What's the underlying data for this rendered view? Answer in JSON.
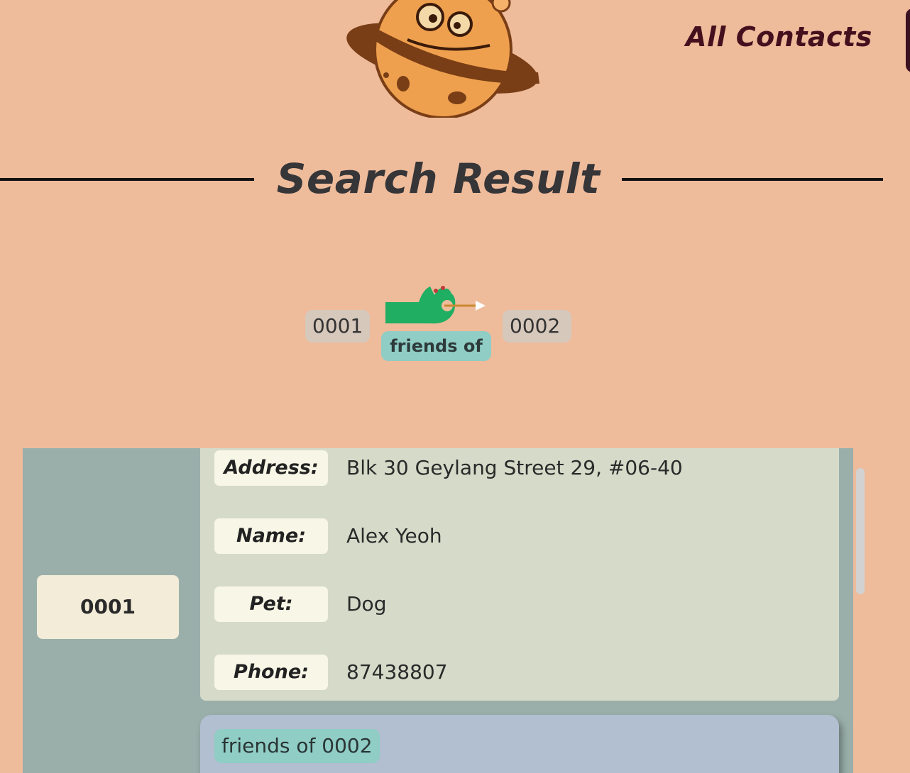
{
  "header": {
    "nav_link": "All Contacts"
  },
  "page_title": "Search Result",
  "relation": {
    "from_id": "0001",
    "to_id": "0002",
    "label": "friends of"
  },
  "result": {
    "contact_id": "0001",
    "fields": [
      {
        "label": "Address:",
        "value": "Blk 30 Geylang Street 29, #06-40"
      },
      {
        "label": "Name:",
        "value": "Alex Yeoh"
      },
      {
        "label": "Pet:",
        "value": "Dog"
      },
      {
        "label": "Phone:",
        "value": "87438807"
      }
    ],
    "tags": [
      "friends of 0002"
    ]
  },
  "colors": {
    "background": "#EEBB9B",
    "nav_link": "#45101E",
    "relation_tag": "#8FCDC5",
    "card": "#9AAFAA",
    "detail_panel": "#D6DAC9",
    "tags_panel": "#B1BFD0"
  },
  "icons": {
    "logo": "cookie-planet-logo",
    "relation": "hand-arrow-icon"
  }
}
